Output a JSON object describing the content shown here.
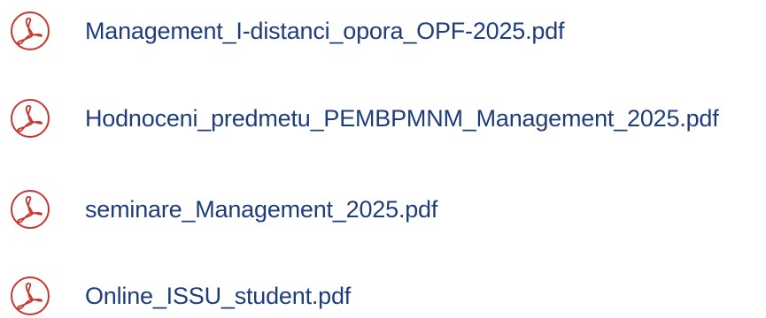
{
  "files": [
    {
      "name": "Management_I-distanci_opora_OPF-2025.pdf",
      "icon": "pdf-icon"
    },
    {
      "name": "Hodnoceni_predmetu_PEMBPMNM_Management_2025.pdf",
      "icon": "pdf-icon"
    },
    {
      "name": "seminare_Management_2025.pdf",
      "icon": "pdf-icon"
    },
    {
      "name": "Online_ISSU_student.pdf",
      "icon": "pdf-icon"
    }
  ],
  "colors": {
    "icon": "#c8372f",
    "link_text": "#1f3d7a",
    "background": "#ffffff"
  }
}
